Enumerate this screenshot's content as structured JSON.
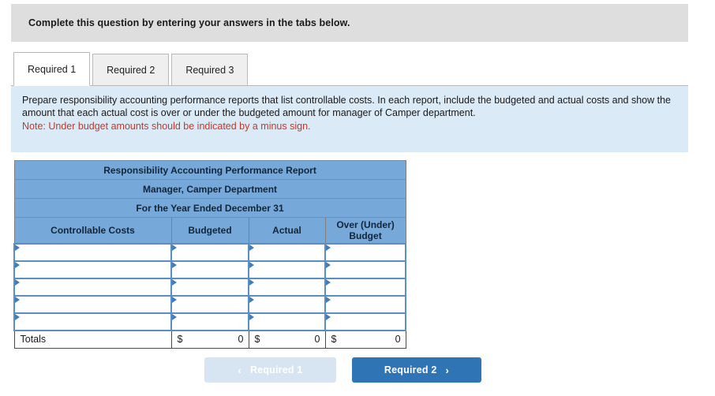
{
  "banner": {
    "text": "Complete this question by entering your answers in the tabs below."
  },
  "tabs": [
    {
      "label": "Required 1",
      "active": true
    },
    {
      "label": "Required 2",
      "active": false
    },
    {
      "label": "Required 3",
      "active": false
    }
  ],
  "instructions": {
    "body": "Prepare responsibility accounting performance reports that list controllable costs. In each report, include the budgeted and actual costs and show the amount that each actual cost is over or under the budgeted amount for manager of Camper department.",
    "note": "Note: Under budget amounts should be indicated by a minus sign."
  },
  "report": {
    "title_line_1": "Responsibility Accounting Performance Report",
    "title_line_2": "Manager, Camper Department",
    "title_line_3": "For the Year Ended December 31",
    "columns": [
      "Controllable Costs",
      "Budgeted",
      "Actual",
      "Over (Under) Budget"
    ],
    "rows": [
      {
        "cost": "",
        "budgeted": "",
        "actual": "",
        "over_under": ""
      },
      {
        "cost": "",
        "budgeted": "",
        "actual": "",
        "over_under": ""
      },
      {
        "cost": "",
        "budgeted": "",
        "actual": "",
        "over_under": ""
      },
      {
        "cost": "",
        "budgeted": "",
        "actual": "",
        "over_under": ""
      },
      {
        "cost": "",
        "budgeted": "",
        "actual": "",
        "over_under": ""
      }
    ],
    "totals": {
      "label": "Totals",
      "currency_symbol": "$",
      "budgeted": "0",
      "actual": "0",
      "over_under": "0"
    }
  },
  "navigation": {
    "prev_label": "Required 1",
    "next_label": "Required 2",
    "prev_icon": "chevron-left-icon",
    "next_icon": "chevron-right-icon",
    "prev_chevron": "‹",
    "next_chevron": "›"
  },
  "colors": {
    "banner_gray": "#dedede",
    "panel_blue": "#dbeaf7",
    "header_blue": "#76a8da",
    "note_red": "#c0392b",
    "button_blue": "#2f75b5",
    "button_disabled": "#d7e5f2"
  }
}
